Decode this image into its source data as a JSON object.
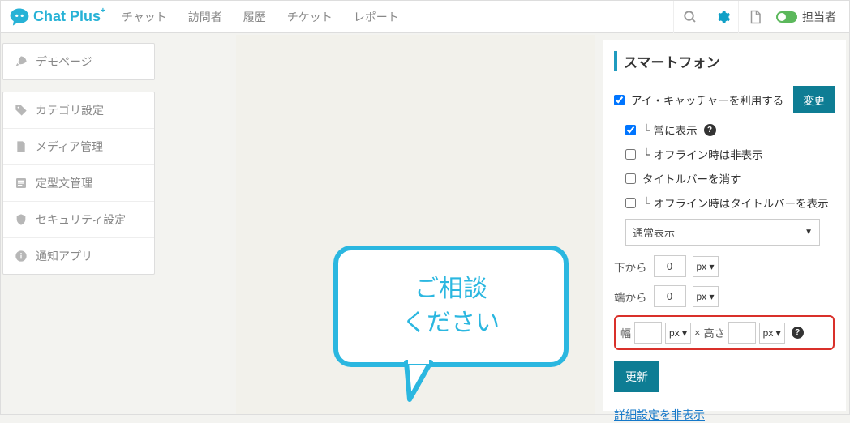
{
  "header": {
    "brand_main": "Chat Plus",
    "brand_sup": "+",
    "nav": [
      "チャット",
      "訪問者",
      "履歴",
      "チケット",
      "レポート"
    ],
    "assignee_label": "担当者"
  },
  "sidebar": {
    "group1": [
      {
        "label": "デモページ"
      }
    ],
    "group2": [
      {
        "label": "カテゴリ設定"
      },
      {
        "label": "メディア管理"
      },
      {
        "label": "定型文管理"
      },
      {
        "label": "セキュリティ設定"
      },
      {
        "label": "通知アプリ"
      }
    ]
  },
  "preview": {
    "bubble_line1": "ご相談",
    "bubble_line2": "ください"
  },
  "panel": {
    "title": "スマートフォン",
    "chk_eyecatcher": "アイ・キャッチャーを利用する",
    "btn_change": "変更",
    "chk_always": "常に表示",
    "chk_offline_hide": "オフライン時は非表示",
    "chk_hide_titlebar": "タイトルバーを消す",
    "chk_offline_titlebar": "オフライン時はタイトルバーを表示",
    "select_display": "通常表示",
    "label_bottom": "下から",
    "label_edge": "端から",
    "val_bottom": "0",
    "val_edge": "0",
    "unit_px": "px ▾",
    "size_width_label": "幅",
    "size_height_label": "高さ",
    "size_times": "×",
    "btn_update": "更新",
    "link_detail": "詳細設定を非表示"
  }
}
